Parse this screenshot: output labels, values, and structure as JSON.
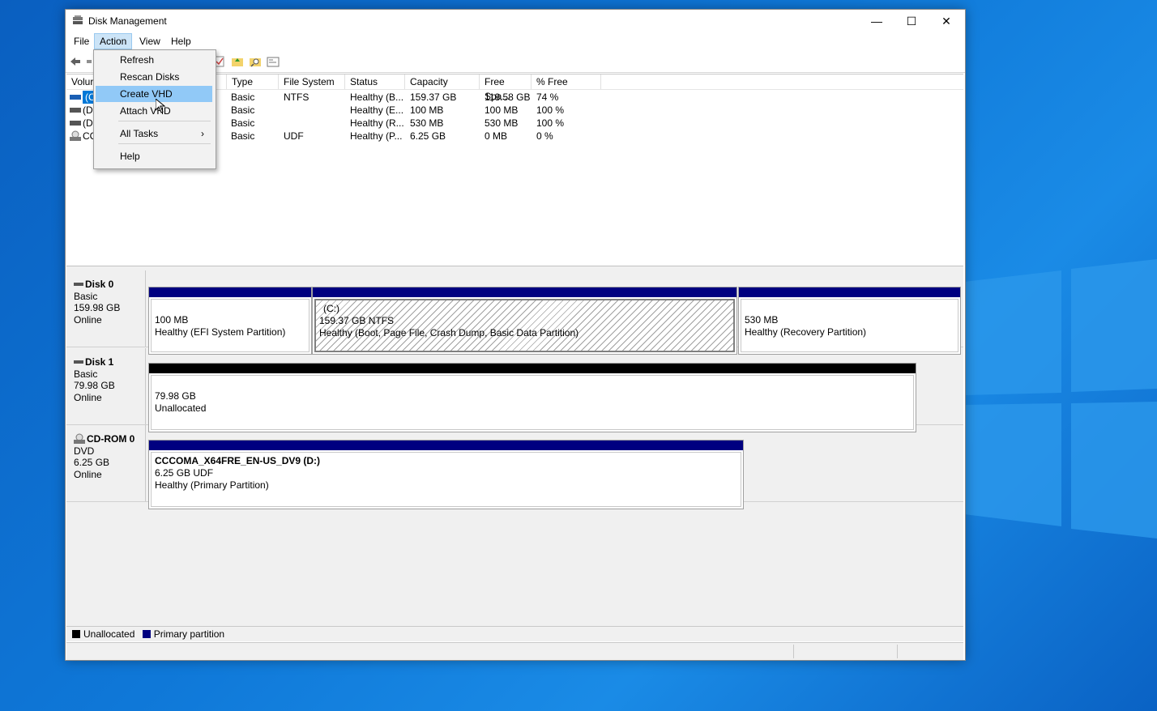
{
  "window": {
    "title": "Disk Management",
    "controls": {
      "minimize": "—",
      "maximize": "☐",
      "close": "✕"
    }
  },
  "menubar": {
    "items": [
      {
        "label": "File"
      },
      {
        "label": "Action"
      },
      {
        "label": "View"
      },
      {
        "label": "Help"
      }
    ]
  },
  "action_menu": {
    "items": [
      {
        "label": "Refresh"
      },
      {
        "label": "Rescan Disks"
      },
      {
        "label": "Create VHD"
      },
      {
        "label": "Attach VHD"
      },
      {
        "label": "All Tasks",
        "submenu_arrow": "›"
      },
      {
        "label": "Help"
      }
    ],
    "highlighted": "Create VHD"
  },
  "volume_list": {
    "columns": [
      "Volur",
      "Type",
      "File System",
      "Status",
      "Capacity",
      "Free Spa...",
      "% Free"
    ],
    "rows": [
      {
        "volume": "(C",
        "type": "Basic",
        "fs": "NTFS",
        "status": "Healthy (B...",
        "capacity": "159.37 GB",
        "free": "118.58 GB",
        "pct": "74 %"
      },
      {
        "volume": "(Di",
        "type": "Basic",
        "fs": "",
        "status": "Healthy (E...",
        "capacity": "100 MB",
        "free": "100 MB",
        "pct": "100 %"
      },
      {
        "volume": "(Di",
        "type": "Basic",
        "fs": "",
        "status": "Healthy (R...",
        "capacity": "530 MB",
        "free": "530 MB",
        "pct": "100 %"
      },
      {
        "volume": "CC",
        "type": "Basic",
        "fs": "UDF",
        "status": "Healthy (P...",
        "capacity": "6.25 GB",
        "free": "0 MB",
        "pct": "0 %"
      }
    ]
  },
  "disks": [
    {
      "name": "Disk 0",
      "type": "Basic",
      "size": "159.98 GB",
      "state": "Online",
      "partitions": [
        {
          "title": "",
          "line1": "100 MB",
          "line2": "Healthy (EFI System Partition)"
        },
        {
          "title": "(C:)",
          "line1": "159.37 GB NTFS",
          "line2": "Healthy (Boot, Page File, Crash Dump, Basic Data Partition)"
        },
        {
          "title": "",
          "line1": "530 MB",
          "line2": "Healthy (Recovery Partition)"
        }
      ]
    },
    {
      "name": "Disk 1",
      "type": "Basic",
      "size": "79.98 GB",
      "state": "Online",
      "partitions": [
        {
          "title": "",
          "line1": "79.98 GB",
          "line2": "Unallocated"
        }
      ]
    },
    {
      "name": "CD-ROM 0",
      "type": "DVD",
      "size": "6.25 GB",
      "state": "Online",
      "partitions": [
        {
          "title": "CCCOMA_X64FRE_EN-US_DV9  (D:)",
          "line1": "6.25 GB UDF",
          "line2": "Healthy (Primary Partition)"
        }
      ]
    }
  ],
  "legend": {
    "unallocated": "Unallocated",
    "primary": "Primary partition"
  },
  "colors": {
    "primary_partition": "#000080",
    "unallocated": "#000000",
    "menu_highlight": "#91c9f7",
    "selection": "#0078d7"
  },
  "icons": [
    "back-arrow-icon",
    "forward-arrow-icon",
    "disk-icon",
    "cdrom-icon",
    "help-icon",
    "properties-icon",
    "folder-icon",
    "search-icon",
    "console-icon"
  ]
}
